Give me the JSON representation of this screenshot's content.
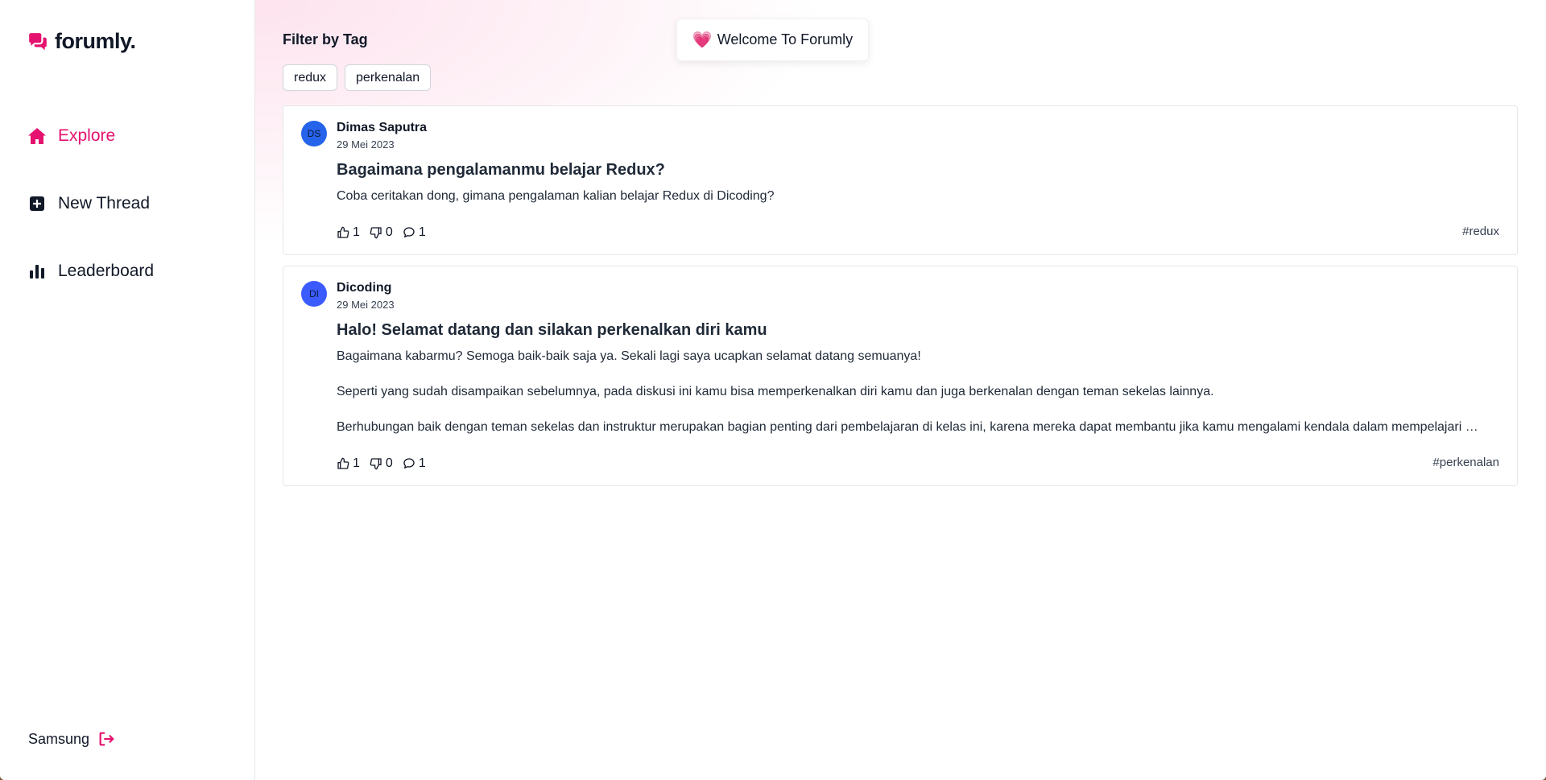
{
  "app": {
    "name": "forumly.",
    "accent_color": "#e5126f",
    "logo_icon": "chat-bubbles-icon"
  },
  "sidebar": {
    "items": [
      {
        "label": "Explore",
        "icon": "home-icon",
        "active": true
      },
      {
        "label": "New Thread",
        "icon": "plus-square-icon",
        "active": false
      },
      {
        "label": "Leaderboard",
        "icon": "bar-chart-icon",
        "active": false
      }
    ],
    "user": {
      "name": "Samsung",
      "logout_icon": "logout-icon"
    }
  },
  "main": {
    "filter_title": "Filter by Tag",
    "welcome": {
      "emoji": "💗",
      "text": "Welcome To Forumly"
    },
    "tags": [
      "redux",
      "perkenalan"
    ],
    "threads": [
      {
        "initials": "DS",
        "author": "Dimas Saputra",
        "date": "29 Mei 2023",
        "title": "Bagaimana pengalamanmu belajar Redux?",
        "body": [
          "Coba ceritakan dong, gimana pengalaman kalian belajar Redux di Dicoding?"
        ],
        "likes": "1",
        "dislikes": "0",
        "comments": "1",
        "tag": "#redux"
      },
      {
        "initials": "DI",
        "author": "Dicoding",
        "date": "29 Mei 2023",
        "title": "Halo! Selamat datang dan silakan perkenalkan diri kamu",
        "body": [
          "Bagaimana kabarmu? Semoga baik-baik saja ya. Sekali lagi saya ucapkan selamat datang semuanya!",
          "Seperti yang sudah disampaikan sebelumnya, pada diskusi ini kamu bisa memperkenalkan diri kamu dan juga berkenalan dengan teman sekelas lainnya.",
          "Berhubungan baik dengan teman sekelas dan instruktur merupakan bagian penting dari pembelajaran di kelas ini, karena mereka dapat membantu jika kamu mengalami kendala dalam mempelajari dan..."
        ],
        "likes": "1",
        "dislikes": "0",
        "comments": "1",
        "tag": "#perkenalan"
      }
    ]
  }
}
